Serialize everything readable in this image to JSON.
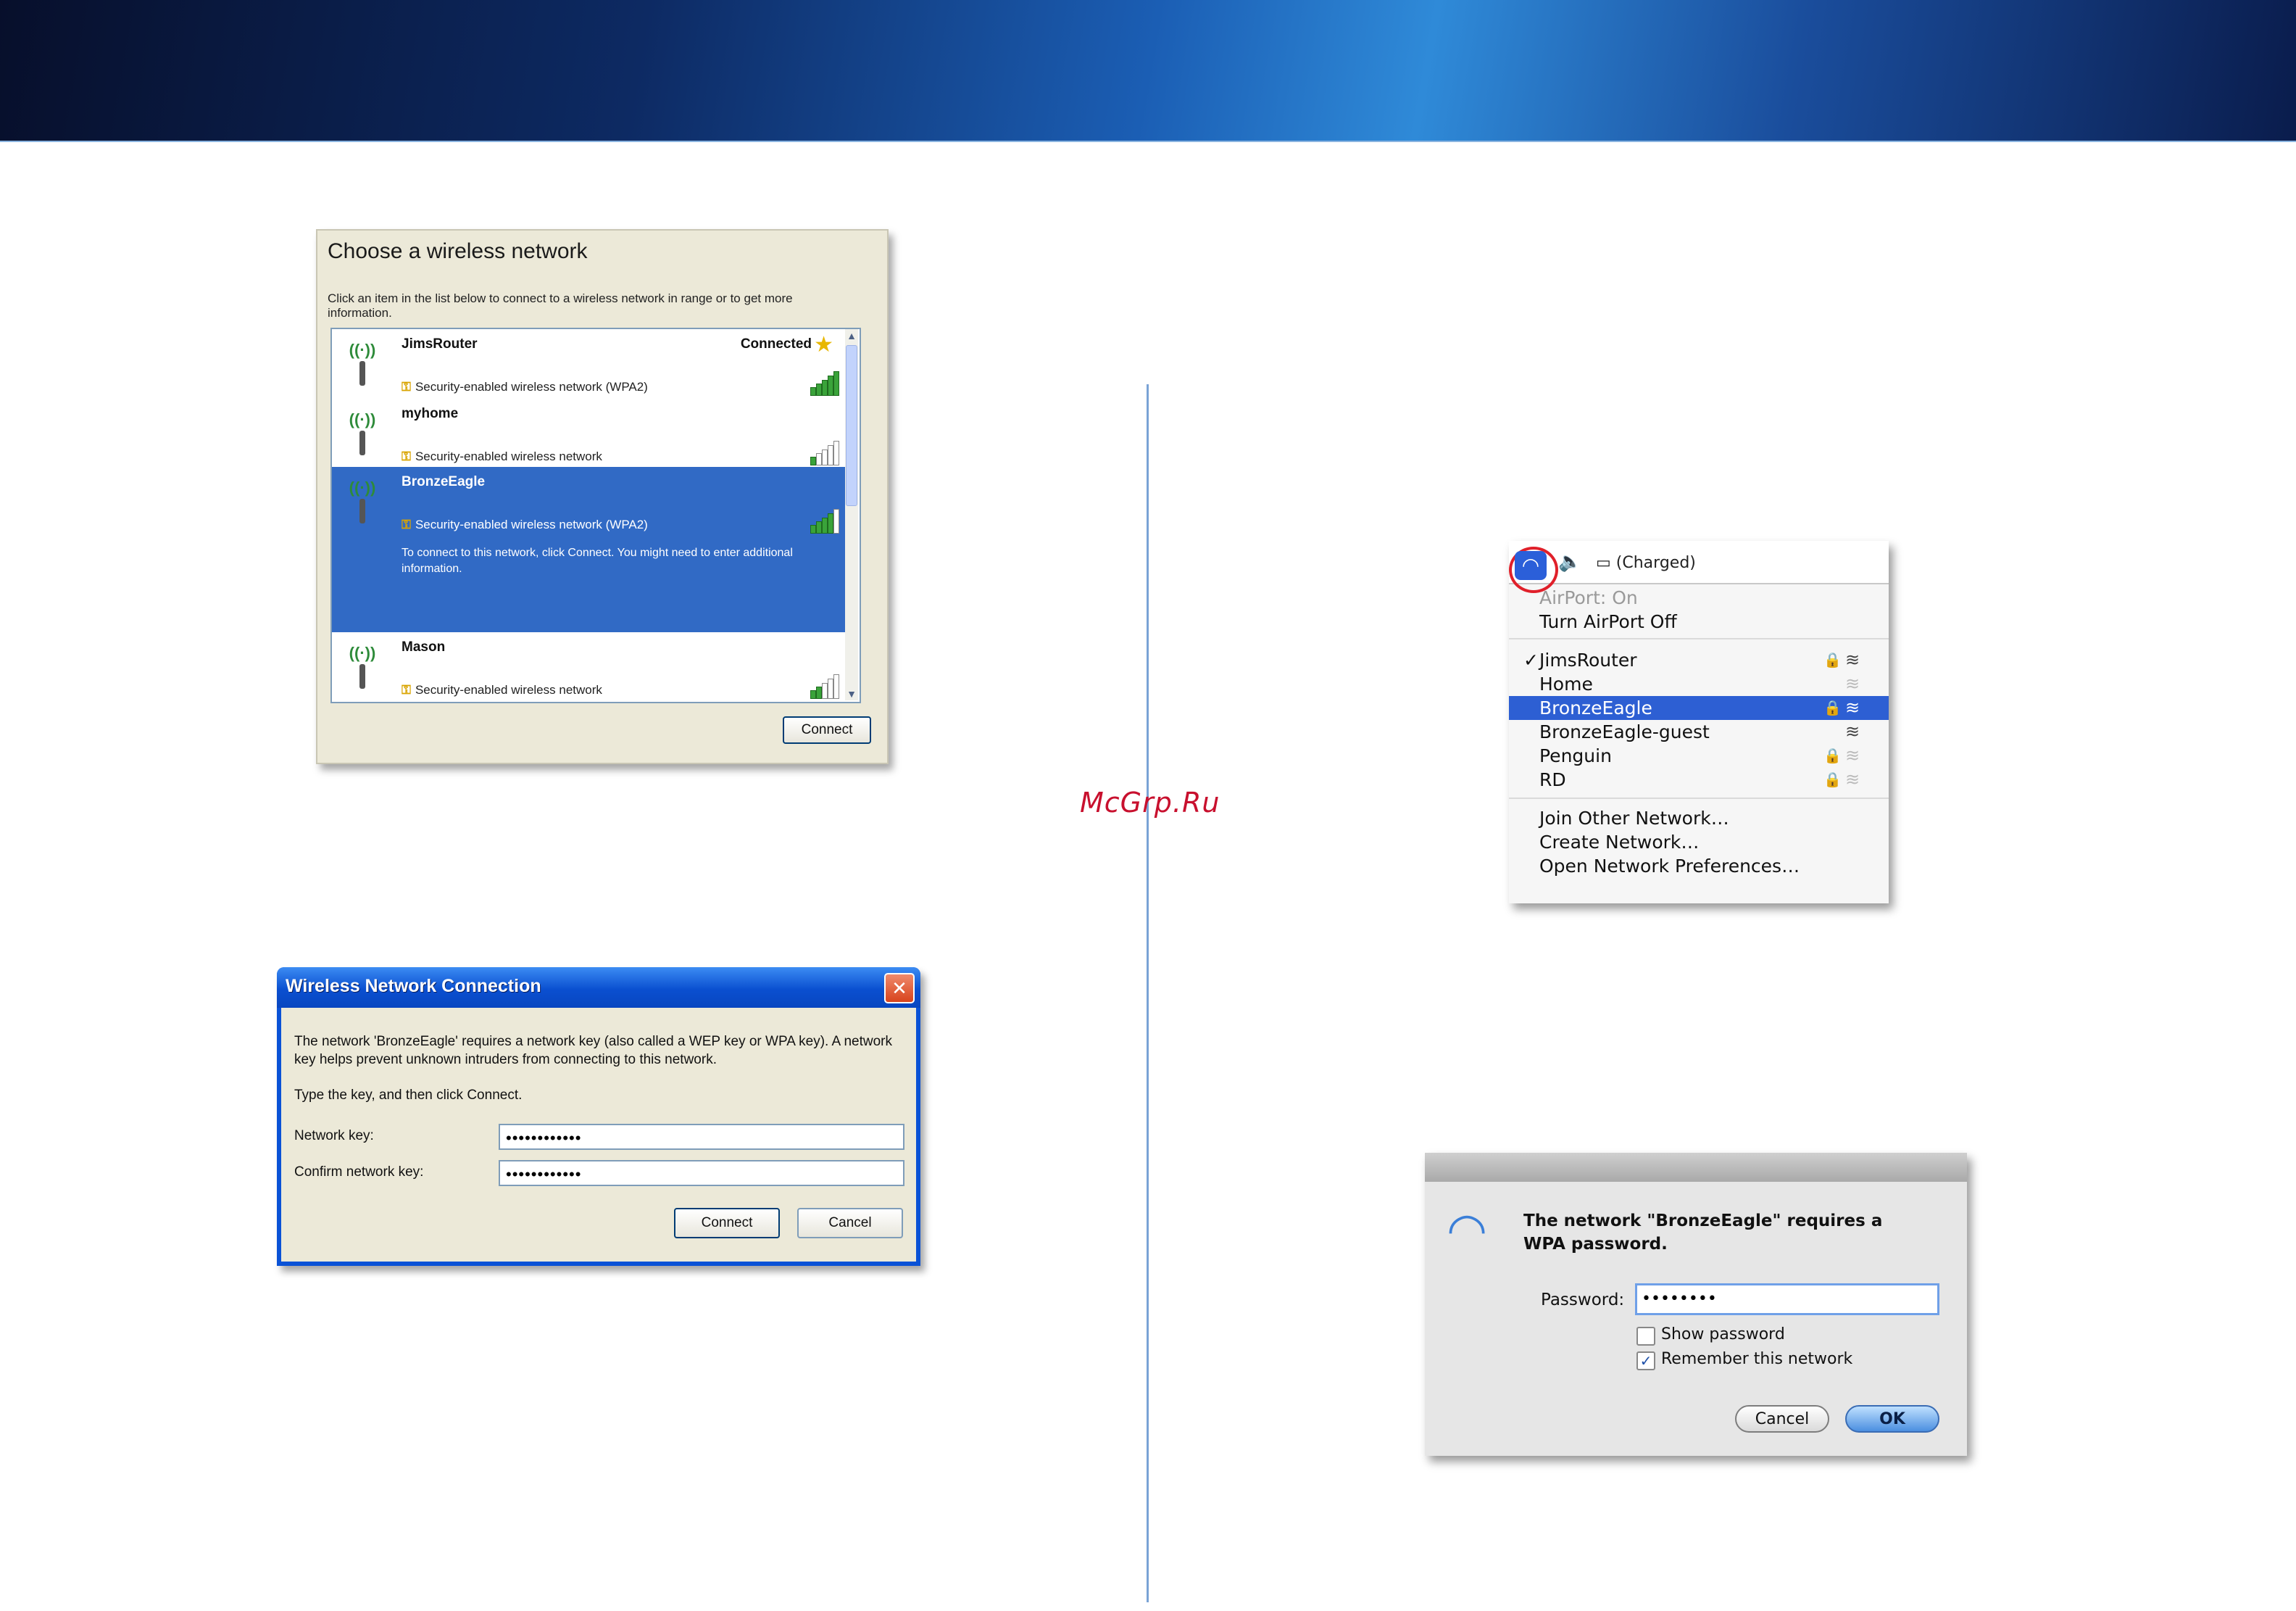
{
  "watermark": "McGrp.Ru",
  "win_choose": {
    "title": "Choose a wireless network",
    "description": "Click an item in the list below to connect to a wireless network in range or to get more information.",
    "networks": [
      {
        "name": "JimsRouter",
        "security": "Security-enabled wireless network (WPA2)",
        "status": "Connected",
        "signal_bars": 5
      },
      {
        "name": "myhome",
        "security": "Security-enabled wireless network",
        "status": "",
        "signal_bars": 1
      },
      {
        "name": "BronzeEagle",
        "security": "Security-enabled wireless network (WPA2)",
        "hint": "To connect to this network, click Connect. You might need to enter additional information.",
        "selected": true,
        "signal_bars": 4
      },
      {
        "name": "Mason",
        "security": "Security-enabled wireless network",
        "status": "",
        "signal_bars": 2
      }
    ],
    "connect_button": "Connect"
  },
  "win_key": {
    "title": "Wireless Network Connection",
    "message": "The network 'BronzeEagle' requires a network key (also called a WEP key or WPA key). A network key helps prevent unknown intruders from connecting to this network.",
    "instruction": "Type the key, and then click Connect.",
    "network_key_label": "Network key:",
    "network_key_value": "••••••••••••",
    "confirm_label": "Confirm network key:",
    "confirm_value": "••••••••••••",
    "connect_button": "Connect",
    "cancel_button": "Cancel",
    "close_symbol": "✕"
  },
  "mac_menu": {
    "battery_status": "(Charged)",
    "airport_status": "AirPort: On",
    "turn_off": "Turn AirPort Off",
    "networks": [
      {
        "name": "JimsRouter",
        "checked": true,
        "locked": true,
        "strong": true
      },
      {
        "name": "Home",
        "checked": false,
        "locked": false,
        "strong": false
      },
      {
        "name": "BronzeEagle",
        "checked": false,
        "locked": true,
        "strong": true,
        "selected": true
      },
      {
        "name": "BronzeEagle-guest",
        "checked": false,
        "locked": false,
        "strong": true
      },
      {
        "name": "Penguin",
        "checked": false,
        "locked": true,
        "strong": false
      },
      {
        "name": "RD",
        "checked": false,
        "locked": true,
        "strong": false
      }
    ],
    "join_other": "Join Other Network…",
    "create_network": "Create Network…",
    "open_prefs": "Open Network Preferences…",
    "check_mark": "✓",
    "lock_symbol": "🔒",
    "wifi_symbol": "≋"
  },
  "mac_pw": {
    "message": "The network \"BronzeEagle\" requires a WPA password.",
    "password_label": "Password:",
    "password_value": "••••••••",
    "show_password": "Show password",
    "show_password_checked": false,
    "remember_network": "Remember this network",
    "remember_network_checked": true,
    "cancel_button": "Cancel",
    "ok_button": "OK"
  },
  "colors": {
    "xp_blue": "#0a52d6",
    "xp_selection": "#316ac5",
    "mac_selection": "#2d5fd3",
    "watermark": "#c8102e"
  }
}
